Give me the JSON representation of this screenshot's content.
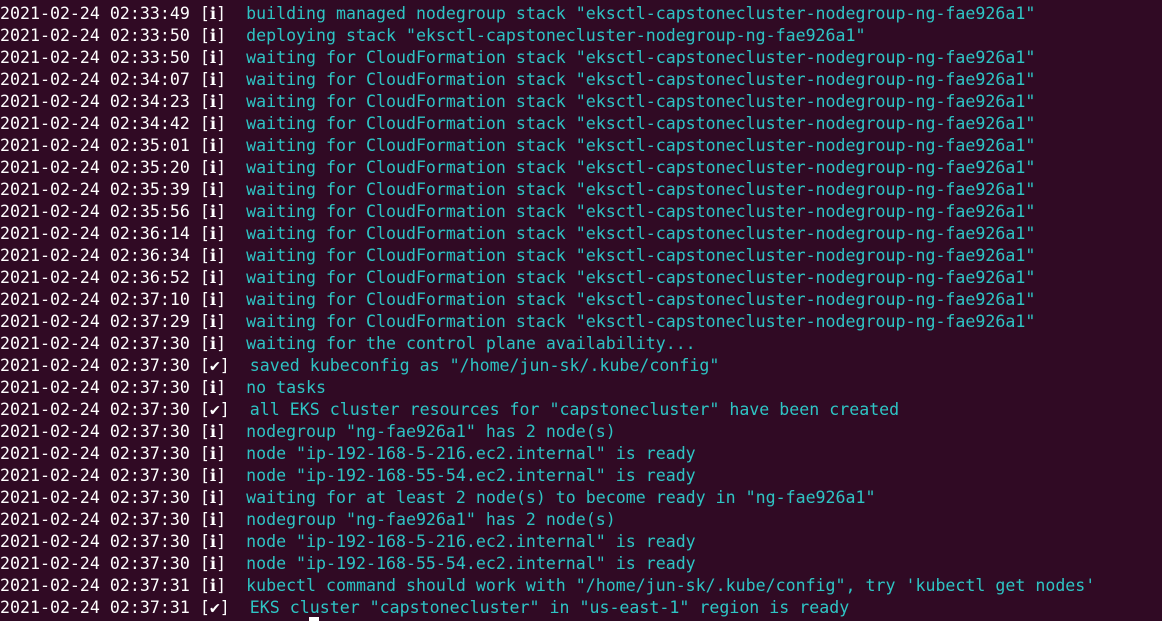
{
  "terminal": {
    "lines": [
      {
        "ts": "2021-02-24 02:33:49",
        "lvl": "[ℹ]",
        "msg": "building managed nodegroup stack \"eksctl-capstonecluster-nodegroup-ng-fae926a1\""
      },
      {
        "ts": "2021-02-24 02:33:50",
        "lvl": "[ℹ]",
        "msg": "deploying stack \"eksctl-capstonecluster-nodegroup-ng-fae926a1\""
      },
      {
        "ts": "2021-02-24 02:33:50",
        "lvl": "[ℹ]",
        "msg": "waiting for CloudFormation stack \"eksctl-capstonecluster-nodegroup-ng-fae926a1\""
      },
      {
        "ts": "2021-02-24 02:34:07",
        "lvl": "[ℹ]",
        "msg": "waiting for CloudFormation stack \"eksctl-capstonecluster-nodegroup-ng-fae926a1\""
      },
      {
        "ts": "2021-02-24 02:34:23",
        "lvl": "[ℹ]",
        "msg": "waiting for CloudFormation stack \"eksctl-capstonecluster-nodegroup-ng-fae926a1\""
      },
      {
        "ts": "2021-02-24 02:34:42",
        "lvl": "[ℹ]",
        "msg": "waiting for CloudFormation stack \"eksctl-capstonecluster-nodegroup-ng-fae926a1\""
      },
      {
        "ts": "2021-02-24 02:35:01",
        "lvl": "[ℹ]",
        "msg": "waiting for CloudFormation stack \"eksctl-capstonecluster-nodegroup-ng-fae926a1\""
      },
      {
        "ts": "2021-02-24 02:35:20",
        "lvl": "[ℹ]",
        "msg": "waiting for CloudFormation stack \"eksctl-capstonecluster-nodegroup-ng-fae926a1\""
      },
      {
        "ts": "2021-02-24 02:35:39",
        "lvl": "[ℹ]",
        "msg": "waiting for CloudFormation stack \"eksctl-capstonecluster-nodegroup-ng-fae926a1\""
      },
      {
        "ts": "2021-02-24 02:35:56",
        "lvl": "[ℹ]",
        "msg": "waiting for CloudFormation stack \"eksctl-capstonecluster-nodegroup-ng-fae926a1\""
      },
      {
        "ts": "2021-02-24 02:36:14",
        "lvl": "[ℹ]",
        "msg": "waiting for CloudFormation stack \"eksctl-capstonecluster-nodegroup-ng-fae926a1\""
      },
      {
        "ts": "2021-02-24 02:36:34",
        "lvl": "[ℹ]",
        "msg": "waiting for CloudFormation stack \"eksctl-capstonecluster-nodegroup-ng-fae926a1\""
      },
      {
        "ts": "2021-02-24 02:36:52",
        "lvl": "[ℹ]",
        "msg": "waiting for CloudFormation stack \"eksctl-capstonecluster-nodegroup-ng-fae926a1\""
      },
      {
        "ts": "2021-02-24 02:37:10",
        "lvl": "[ℹ]",
        "msg": "waiting for CloudFormation stack \"eksctl-capstonecluster-nodegroup-ng-fae926a1\""
      },
      {
        "ts": "2021-02-24 02:37:29",
        "lvl": "[ℹ]",
        "msg": "waiting for CloudFormation stack \"eksctl-capstonecluster-nodegroup-ng-fae926a1\""
      },
      {
        "ts": "2021-02-24 02:37:30",
        "lvl": "[ℹ]",
        "msg": "waiting for the control plane availability..."
      },
      {
        "ts": "2021-02-24 02:37:30",
        "lvl": "[✔]",
        "msg": "saved kubeconfig as \"/home/jun-sk/.kube/config\""
      },
      {
        "ts": "2021-02-24 02:37:30",
        "lvl": "[ℹ]",
        "msg": "no tasks"
      },
      {
        "ts": "2021-02-24 02:37:30",
        "lvl": "[✔]",
        "msg": "all EKS cluster resources for \"capstonecluster\" have been created"
      },
      {
        "ts": "2021-02-24 02:37:30",
        "lvl": "[ℹ]",
        "msg": "nodegroup \"ng-fae926a1\" has 2 node(s)"
      },
      {
        "ts": "2021-02-24 02:37:30",
        "lvl": "[ℹ]",
        "msg": "node \"ip-192-168-5-216.ec2.internal\" is ready"
      },
      {
        "ts": "2021-02-24 02:37:30",
        "lvl": "[ℹ]",
        "msg": "node \"ip-192-168-55-54.ec2.internal\" is ready"
      },
      {
        "ts": "2021-02-24 02:37:30",
        "lvl": "[ℹ]",
        "msg": "waiting for at least 2 node(s) to become ready in \"ng-fae926a1\""
      },
      {
        "ts": "2021-02-24 02:37:30",
        "lvl": "[ℹ]",
        "msg": "nodegroup \"ng-fae926a1\" has 2 node(s)"
      },
      {
        "ts": "2021-02-24 02:37:30",
        "lvl": "[ℹ]",
        "msg": "node \"ip-192-168-5-216.ec2.internal\" is ready"
      },
      {
        "ts": "2021-02-24 02:37:30",
        "lvl": "[ℹ]",
        "msg": "node \"ip-192-168-55-54.ec2.internal\" is ready"
      },
      {
        "ts": "2021-02-24 02:37:31",
        "lvl": "[ℹ]",
        "msg": "kubectl command should work with \"/home/jun-sk/.kube/config\", try 'kubectl get nodes'"
      },
      {
        "ts": "2021-02-24 02:37:31",
        "lvl": "[✔]",
        "msg": "EKS cluster \"capstonecluster\" in \"us-east-1\" region is ready"
      }
    ]
  },
  "colors": {
    "background": "#300a24",
    "timestamp": "#ffffff",
    "message": "#2ec4c4"
  }
}
